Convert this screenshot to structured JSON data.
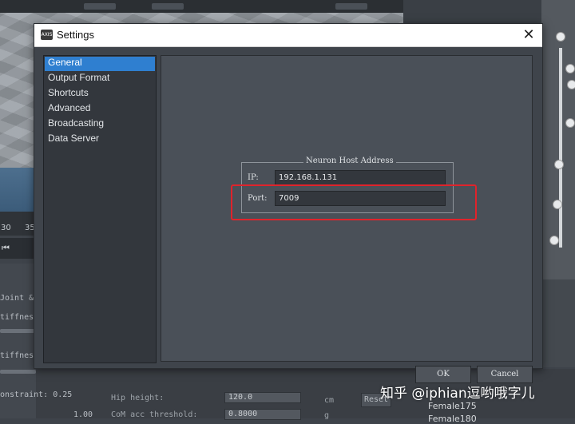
{
  "dialog": {
    "title": "Settings",
    "app_icon_text": "AXIS",
    "close_glyph": "✕"
  },
  "nav": {
    "items": [
      {
        "label": "General",
        "selected": true
      },
      {
        "label": "Output Format",
        "selected": false
      },
      {
        "label": "Shortcuts",
        "selected": false
      },
      {
        "label": "Advanced",
        "selected": false
      },
      {
        "label": "Broadcasting",
        "selected": false
      },
      {
        "label": "Data Server",
        "selected": false
      }
    ]
  },
  "neuron_host": {
    "group_title": "Neuron Host Address",
    "ip_label": "IP:",
    "ip_value": "192.168.1.131",
    "port_label": "Port:",
    "port_value": "7009"
  },
  "footer": {
    "ok_label": "OK",
    "cancel_label": "Cancel"
  },
  "background": {
    "ruler_left": "30",
    "ruler_right": "35",
    "rewind_glyph": "⏮",
    "left_labels": [
      "Joint &",
      "tiffnes",
      "tiffness",
      "onstraint: 0.25"
    ],
    "slider_value": "1.00",
    "hip_height_label": "Hip height:",
    "hip_height_value": "120.0",
    "hip_height_unit": "cm",
    "com_label": "CoM acc threshold:",
    "com_value": "0.8000",
    "com_unit": "g",
    "reset_label": "Reset",
    "list_item": "Female175",
    "list_item_partial": "Female180"
  },
  "watermark": "知乎 @iphian逗哟哦字儿",
  "colors": {
    "selection": "#2f7fd0",
    "highlight": "#e0232b"
  }
}
